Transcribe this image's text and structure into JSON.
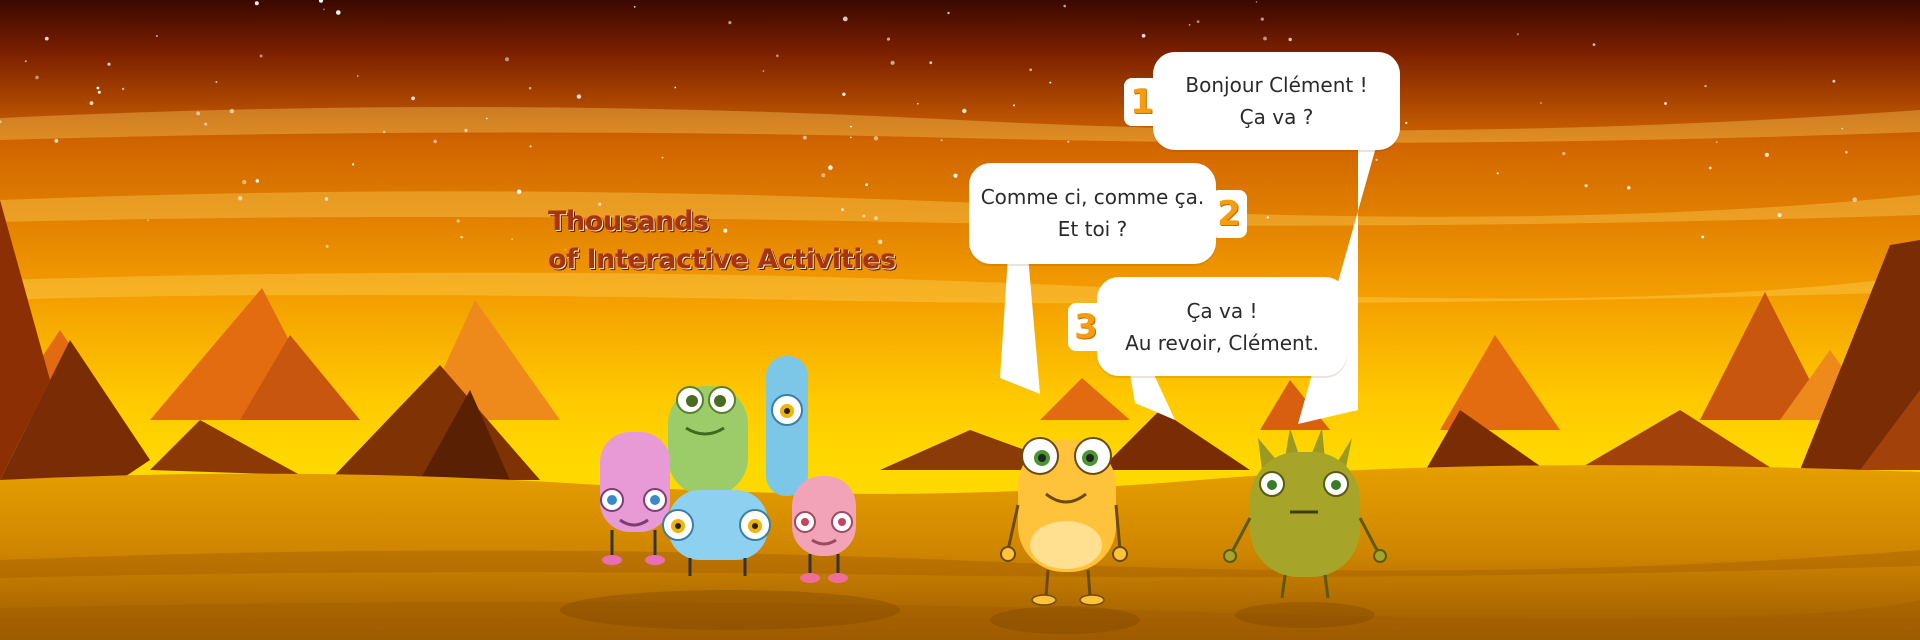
{
  "scene": {
    "colors": {
      "sky_top": "#3a0800",
      "sky_mid": "#e07a00",
      "sky_low": "#ffce00",
      "ground": "#d58a00",
      "ground_dark": "#a05e00",
      "mountain_dark": "#7a2c05",
      "mountain_mid": "#c9560e",
      "mountain_light": "#ee8a1c",
      "headline_text": "#a8340f",
      "badge_number": "#f49d10"
    },
    "monsters": [
      {
        "name": "pink-monster",
        "color": "#e89ad6"
      },
      {
        "name": "green-monster",
        "color": "#9ccc6a"
      },
      {
        "name": "blue-tall-monster",
        "color": "#7cc6e8"
      },
      {
        "name": "blue-round-monster",
        "color": "#8ed0ef"
      },
      {
        "name": "rose-monster",
        "color": "#f2a3b8"
      },
      {
        "name": "yellow-monster",
        "color": "#ffc23a"
      },
      {
        "name": "olive-spiky-monster",
        "color": "#a6a52a"
      }
    ]
  },
  "headline": {
    "line1": "Thousands",
    "line2": "of Interactive Activities"
  },
  "dialogue": [
    {
      "number": "1",
      "line1": "Bonjour Clément !",
      "line2": "Ça va ?"
    },
    {
      "number": "2",
      "line1": "Comme ci, comme ça.",
      "line2": "Et toi ?"
    },
    {
      "number": "3",
      "line1": "Ça va !",
      "line2": "Au revoir, Clément."
    }
  ]
}
